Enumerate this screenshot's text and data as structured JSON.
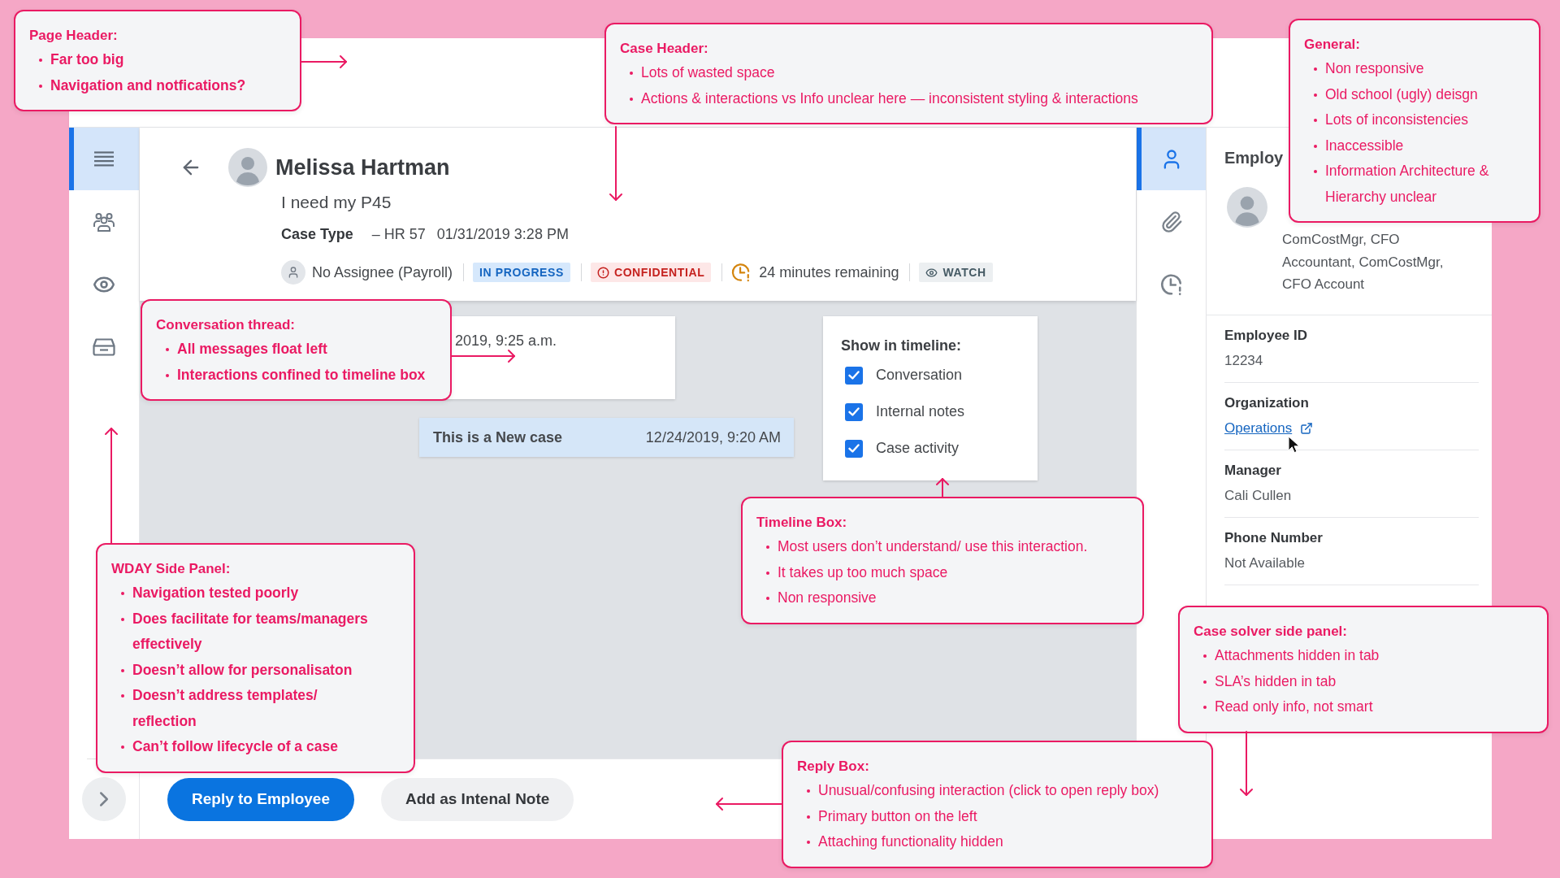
{
  "nav": {
    "items": [
      {
        "selected": true
      },
      {
        "selected": false
      },
      {
        "selected": false
      },
      {
        "selected": false
      }
    ]
  },
  "case_header": {
    "name": "Melissa Hartman",
    "subject": "I need my P45",
    "case_type_label": "Case Type",
    "case_type": "– HR 57",
    "opened": "01/31/2019 3:28 PM",
    "meta": [
      {
        "kind": "assignee",
        "label": "No Assignee (Payroll)"
      },
      {
        "kind": "status",
        "label": "IN PROGRESS"
      },
      {
        "kind": "alert",
        "label": "CONFIDENTIAL"
      },
      {
        "kind": "timer",
        "label": "24 minutes remaining"
      },
      {
        "kind": "watch",
        "label": "WATCH"
      }
    ]
  },
  "timeline": {
    "entries": [
      {
        "kind": "message",
        "text": "2019, 9:25 a.m."
      },
      {
        "kind": "event",
        "text": "This is a New case",
        "time": "12/24/2019, 9:20 AM"
      }
    ],
    "filter": {
      "title": "Show in timeline:",
      "options": [
        {
          "label": "Conversation",
          "checked": true
        },
        {
          "label": "Internal notes",
          "checked": true
        },
        {
          "label": "Case activity",
          "checked": true
        }
      ]
    }
  },
  "actions": [
    {
      "kind": "primary",
      "label": "Reply to Employee"
    },
    {
      "kind": "secondary",
      "label": "Add as Intenal Note"
    }
  ],
  "side_tabs": [
    {
      "selected": true
    },
    {
      "selected": false
    },
    {
      "selected": false
    }
  ],
  "employee_panel": {
    "title": "Employ",
    "roles": "ComCostMgr, CFO Accountant, ComCostMgr, CFO Account",
    "fields": [
      {
        "kind": "text",
        "label": "Employee ID",
        "value": "12234"
      },
      {
        "kind": "link",
        "label": "Organization",
        "value": "Operations"
      },
      {
        "kind": "text",
        "label": "Manager",
        "value": "Cali Cullen"
      },
      {
        "kind": "text",
        "label": "Phone Number",
        "value": "Not Available"
      }
    ]
  },
  "annotations": [
    {
      "kind": "strong",
      "title": "Page Header:",
      "points": [
        "Far too big",
        "Navigation and notfications?"
      ]
    },
    {
      "kind": "plain",
      "title": "Case Header:",
      "points": [
        "Lots of wasted space",
        "Actions & interactions vs Info unclear here — inconsistent styling & interactions"
      ]
    },
    {
      "kind": "plain",
      "title": "General:",
      "points": [
        "Non responsive",
        "Old school (ugly) deisgn",
        "Lots of inconsistencies",
        "Inaccessible",
        "Information Architecture & Hierarchy unclear"
      ]
    },
    {
      "kind": "strong",
      "title": "Conversation thread:",
      "points": [
        "All messages float left",
        "Interactions confined to timeline box"
      ]
    },
    {
      "kind": "plain",
      "title": "Timeline Box:",
      "points": [
        "Most users don’t understand/ use this interaction.",
        "It takes up too much space",
        "Non responsive"
      ]
    },
    {
      "kind": "strong",
      "title": "WDAY Side Panel:",
      "points": [
        "Navigation tested poorly",
        "Does facilitate for teams/managers effectively",
        "Doesn’t allow for personalisaton",
        "Doesn’t address templates/ reflection",
        "Can’t follow lifecycle of a case"
      ]
    },
    {
      "kind": "plain",
      "title": "Case solver side panel:",
      "points": [
        "Attachments hidden in tab",
        "SLA’s hidden in tab",
        "Read only info, not smart"
      ]
    },
    {
      "kind": "plain",
      "title": "Reply Box:",
      "points": [
        "Unusual/confusing interaction (click to open reply box)",
        "Primary button on the left",
        "Attaching functionality hidden"
      ]
    }
  ]
}
